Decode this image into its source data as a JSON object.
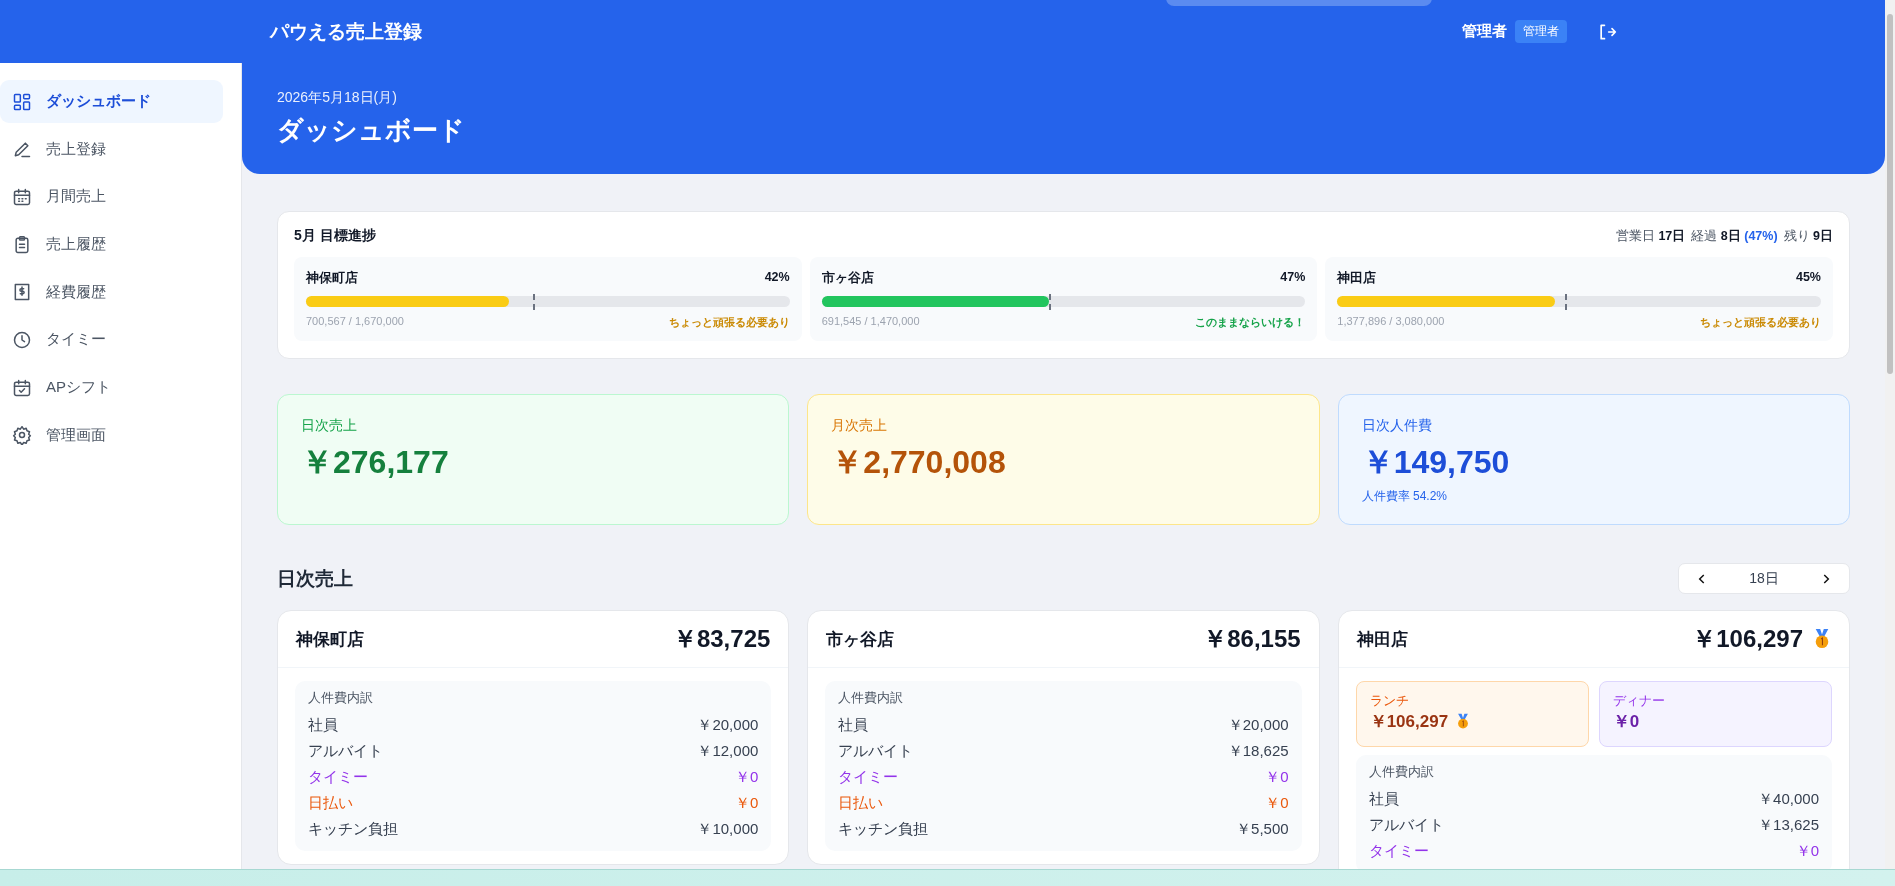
{
  "header": {
    "title": "パウえる売上登録",
    "user_name": "管理者",
    "role_badge": "管理者"
  },
  "sidebar": {
    "items": [
      {
        "label": "ダッシュボード",
        "selected": true
      },
      {
        "label": "売上登録",
        "selected": false
      },
      {
        "label": "月間売上",
        "selected": false
      },
      {
        "label": "売上履歴",
        "selected": false
      },
      {
        "label": "経費履歴",
        "selected": false
      },
      {
        "label": "タイミー",
        "selected": false
      },
      {
        "label": "APシフト",
        "selected": false
      },
      {
        "label": "管理画面",
        "selected": false
      }
    ]
  },
  "page_header": {
    "date": "2026年5月18日(月)",
    "title": "ダッシュボード"
  },
  "goal_progress": {
    "title": "5月 目標進捗",
    "business_days": {
      "label": "営業日",
      "value": "17日"
    },
    "elapsed": {
      "label": "経過",
      "value": "8日",
      "percent": "(47%)"
    },
    "remaining": {
      "label": "残り",
      "value": "9日"
    },
    "pace": {
      "level": 0.47
    },
    "stores": [
      {
        "name": "神保町店",
        "percent": "42%",
        "level": 0.42,
        "amounts": "700,567 / 1,670,000",
        "status": "ちょっと頑張る必要あり",
        "kind": "warning"
      },
      {
        "name": "市ヶ谷店",
        "percent": "47%",
        "level": 0.47,
        "amounts": "691,545 / 1,470,000",
        "status": "このままならいける！",
        "kind": "good"
      },
      {
        "name": "神田店",
        "percent": "45%",
        "level": 0.45,
        "amounts": "1,377,896 / 3,080,000",
        "status": "ちょっと頑張る必要あり",
        "kind": "warning"
      }
    ]
  },
  "stats": [
    {
      "kind": "daily",
      "label": "日次売上",
      "value": "￥276,177"
    },
    {
      "kind": "monthly",
      "label": "月次売上",
      "value": "￥2,770,008"
    },
    {
      "kind": "labor",
      "label": "日次人件費",
      "value": "￥149,750",
      "note": "人件費率 54.2%"
    }
  ],
  "daily_sales": {
    "title": "日次売上",
    "day": "18日",
    "stores": [
      {
        "name": "神保町店",
        "total": "￥83,725",
        "medal": false,
        "breakdown_title": "人件費内訳",
        "rows": [
          {
            "label": "社員",
            "value": "￥20,000",
            "kind": "normal"
          },
          {
            "label": "アルバイト",
            "value": "￥12,000",
            "kind": "normal"
          },
          {
            "label": "タイミー",
            "value": "￥0",
            "kind": "timee"
          },
          {
            "label": "日払い",
            "value": "￥0",
            "kind": "daypay"
          },
          {
            "label": "キッチン負担",
            "value": "￥10,000",
            "kind": "normal"
          }
        ]
      },
      {
        "name": "市ヶ谷店",
        "total": "￥86,155",
        "medal": false,
        "breakdown_title": "人件費内訳",
        "rows": [
          {
            "label": "社員",
            "value": "￥20,000",
            "kind": "normal"
          },
          {
            "label": "アルバイト",
            "value": "￥18,625",
            "kind": "normal"
          },
          {
            "label": "タイミー",
            "value": "￥0",
            "kind": "timee"
          },
          {
            "label": "日払い",
            "value": "￥0",
            "kind": "daypay"
          },
          {
            "label": "キッチン負担",
            "value": "￥5,500",
            "kind": "normal"
          }
        ]
      },
      {
        "name": "神田店",
        "total": "￥106,297",
        "medal": true,
        "shifts": [
          {
            "kind": "lunch",
            "label": "ランチ",
            "value": "￥106,297",
            "medal": true
          },
          {
            "kind": "dinner",
            "label": "ディナー",
            "value": "￥0",
            "medal": false
          }
        ],
        "breakdown_title": "人件費内訳",
        "rows": [
          {
            "label": "社員",
            "value": "￥40,000",
            "kind": "normal"
          },
          {
            "label": "アルバイト",
            "value": "￥13,625",
            "kind": "normal"
          },
          {
            "label": "タイミー",
            "value": "￥0",
            "kind": "timee"
          }
        ]
      }
    ]
  }
}
